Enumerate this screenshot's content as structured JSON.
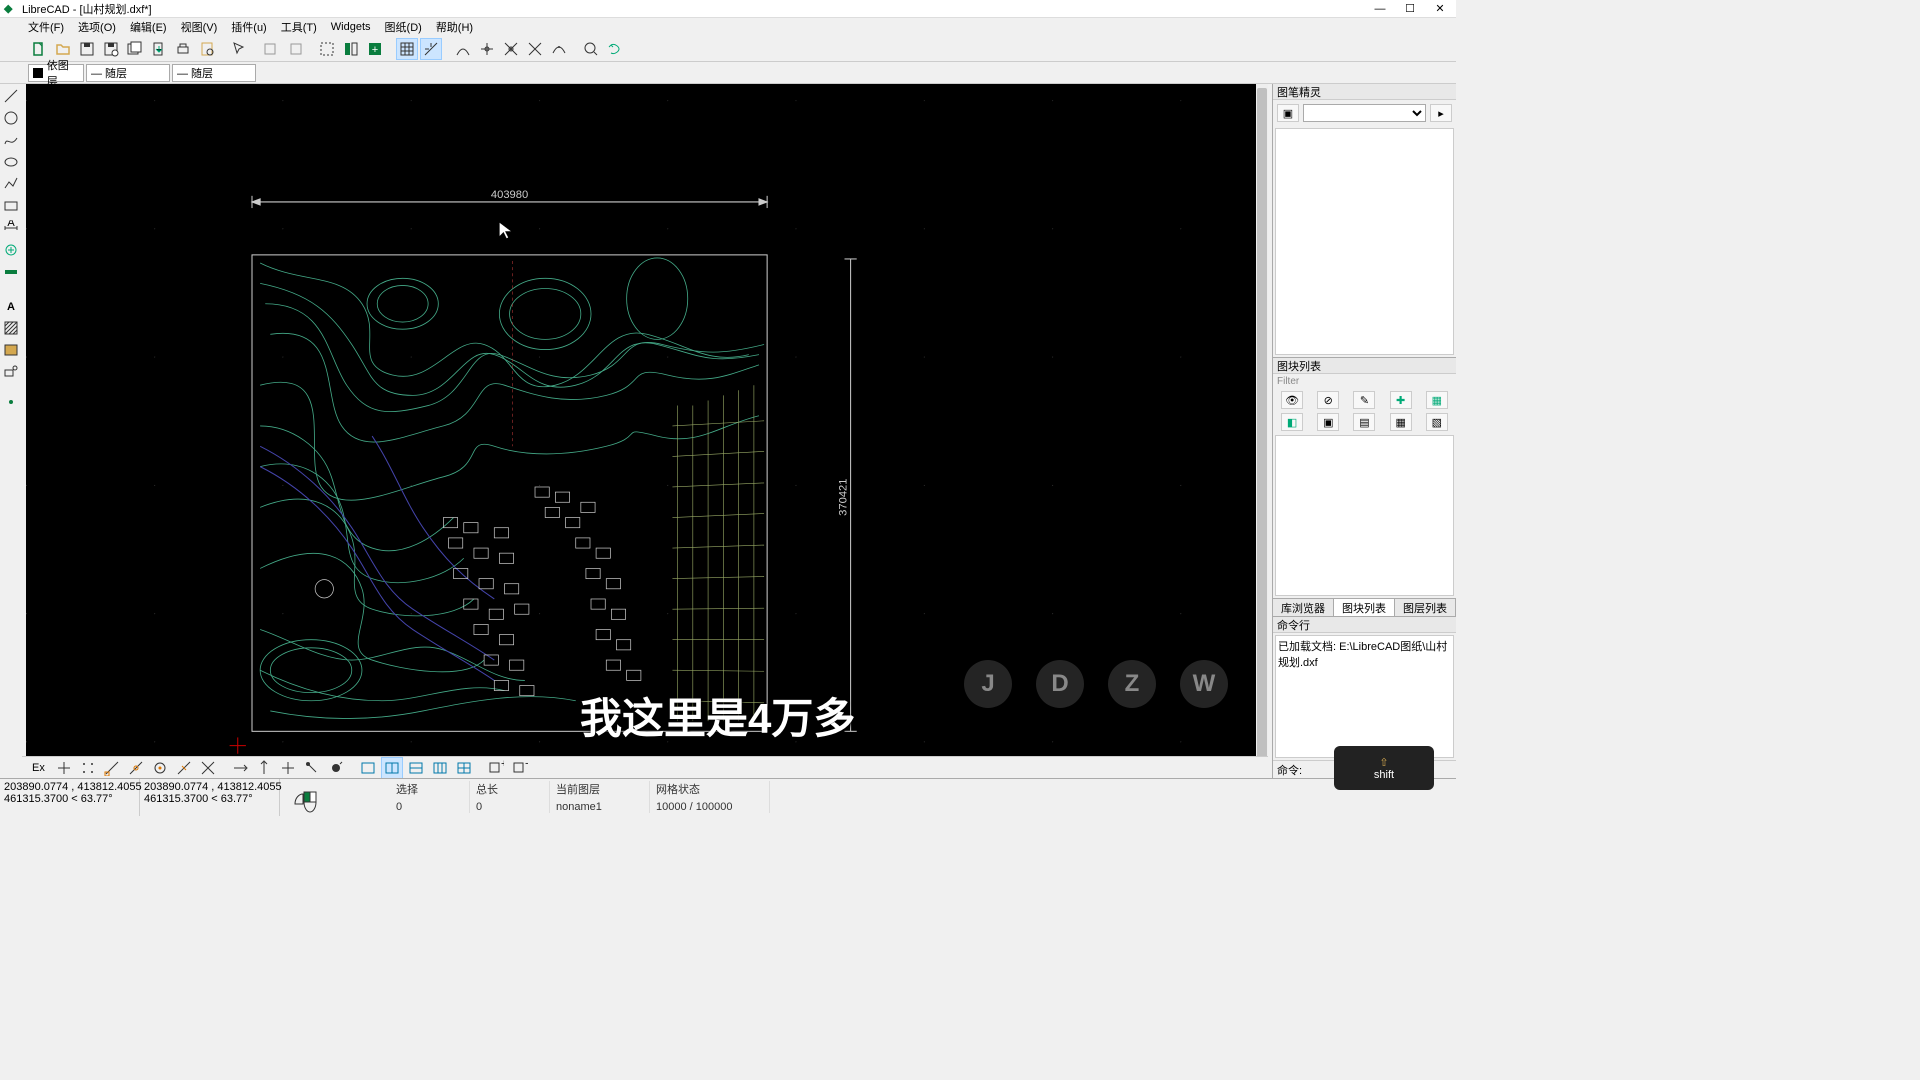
{
  "app": {
    "title": "LibreCAD - [山村规划.dxf*]"
  },
  "menu": [
    "文件(F)",
    "选项(O)",
    "编辑(E)",
    "视图(V)",
    "插件(u)",
    "工具(T)",
    "Widgets",
    "图纸(D)",
    "帮助(H)"
  ],
  "layerCombo": {
    "label": "依图层"
  },
  "lineCombo1": {
    "label": "— 随层"
  },
  "lineCombo2": {
    "label": "— 随层"
  },
  "rightPanels": {
    "pen": {
      "title": "图笔精灵"
    },
    "block": {
      "title": "图块列表",
      "filter": "Filter"
    },
    "tabs": [
      "库浏览器",
      "图块列表",
      "图层列表"
    ],
    "cmd": {
      "title": "命令行",
      "loaded": "已加载文档:  E:\\LibreCAD图纸\\山村规划.dxf",
      "prompt": "命令:"
    }
  },
  "drawing": {
    "dim_h": "403980",
    "dim_v": "370421"
  },
  "overlay": {
    "caption": "我这里是4万多"
  },
  "canvasLetters": [
    "J",
    "D",
    "Z",
    "W"
  ],
  "keyOverlay": {
    "arrow": "⇧",
    "label": "shift"
  },
  "bottomToolbar": {
    "ex": "Ex"
  },
  "status": {
    "coords1": {
      "abs": "203890.0774 , 413812.4055",
      "rel": "461315.3700 < 63.77°"
    },
    "coords2": {
      "abs": "203890.0774 , 413812.4055",
      "rel": "461315.3700 < 63.77°"
    },
    "cols": [
      {
        "h": "选择",
        "v": "0"
      },
      {
        "h": "总长",
        "v": "0"
      },
      {
        "h": "当前图层",
        "v": "noname1"
      },
      {
        "h": "网格状态",
        "v": "10000 / 100000"
      }
    ]
  }
}
